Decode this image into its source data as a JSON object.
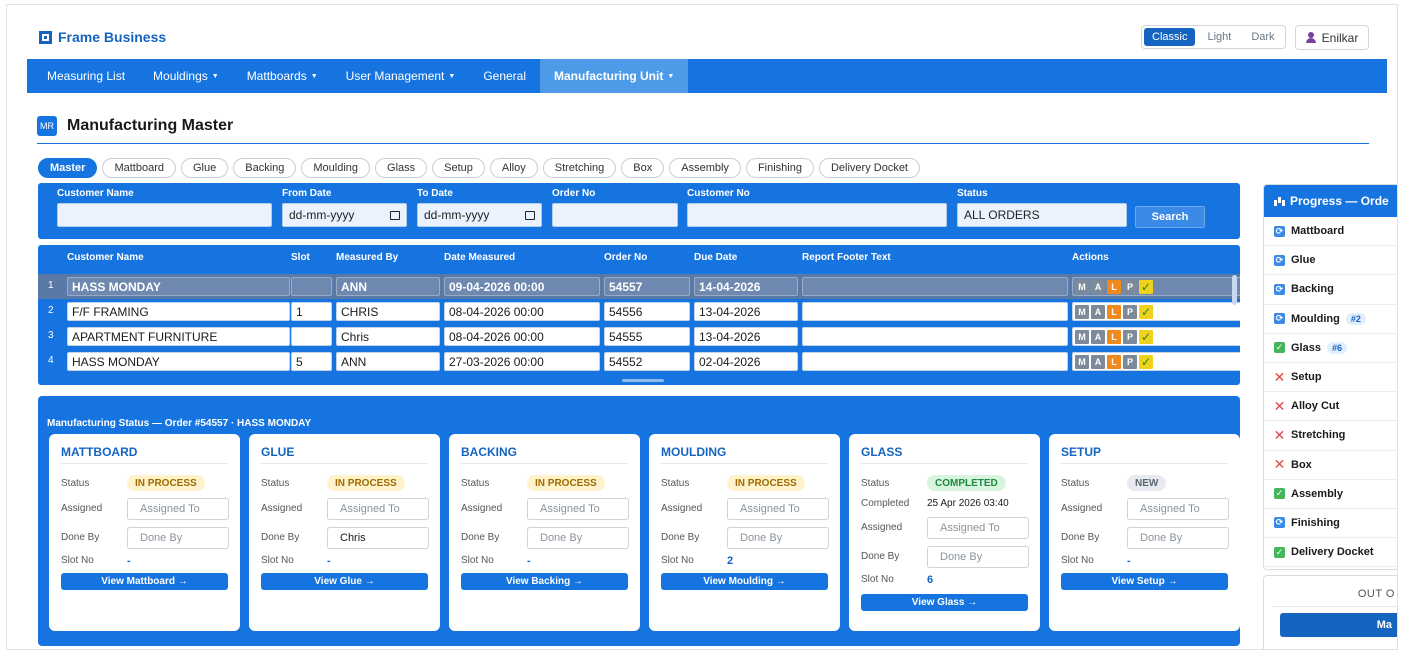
{
  "app": {
    "brand": "Frame Business",
    "themes": [
      "Classic",
      "Light",
      "Dark"
    ],
    "user": "Enilkar"
  },
  "nav": [
    {
      "label": "Measuring List",
      "caret": false
    },
    {
      "label": "Mouldings",
      "caret": true
    },
    {
      "label": "Mattboards",
      "caret": true
    },
    {
      "label": "User Management",
      "caret": true
    },
    {
      "label": "General",
      "caret": false
    },
    {
      "label": "Manufacturing Unit",
      "caret": true
    }
  ],
  "page": {
    "title": "Manufacturing Master",
    "icon_text": "MR"
  },
  "tabs": [
    "Master",
    "Mattboard",
    "Glue",
    "Backing",
    "Moulding",
    "Glass",
    "Setup",
    "Alloy",
    "Stretching",
    "Box",
    "Assembly",
    "Finishing",
    "Delivery Docket"
  ],
  "filters": {
    "customer_name_label": "Customer Name",
    "customer_name_value": "",
    "from_date_label": "From Date",
    "from_date_value": "dd-mm-yyyy",
    "to_date_label": "To Date",
    "to_date_value": "dd-mm-yyyy",
    "order_no_label": "Order No",
    "order_no_value": "",
    "customer_no_label": "Customer No",
    "customer_no_value": "",
    "status_label": "Status",
    "status_value": "ALL ORDERS",
    "search_label": "Search"
  },
  "orders": {
    "columns": [
      "Customer Name",
      "Slot",
      "Measured By",
      "Date Measured",
      "Order No",
      "Due Date",
      "Report Footer Text",
      "Actions"
    ],
    "action_labels": [
      "M",
      "A",
      "L",
      "P",
      "✓"
    ],
    "rows": [
      {
        "num": "1",
        "customer": "HASS MONDAY",
        "slot": "",
        "measured_by": "ANN",
        "date_measured": "09-04-2026 00:00",
        "order_no": "54557",
        "due_date": "14-04-2026",
        "footer": ""
      },
      {
        "num": "2",
        "customer": "F/F FRAMING",
        "slot": "1",
        "measured_by": "CHRIS",
        "date_measured": "08-04-2026 00:00",
        "order_no": "54556",
        "due_date": "13-04-2026",
        "footer": ""
      },
      {
        "num": "3",
        "customer": "APARTMENT FURNITURE",
        "slot": "",
        "measured_by": "Chris",
        "date_measured": "08-04-2026 00:00",
        "order_no": "54555",
        "due_date": "13-04-2026",
        "footer": ""
      },
      {
        "num": "4",
        "customer": "HASS MONDAY",
        "slot": "5",
        "measured_by": "ANN",
        "date_measured": "27-03-2026 00:00",
        "order_no": "54552",
        "due_date": "02-04-2026",
        "footer": ""
      }
    ]
  },
  "status_panel": {
    "title": "Manufacturing Status — Order #54557 · HASS MONDAY",
    "labels": {
      "status": "Status",
      "assigned": "Assigned",
      "done_by": "Done By",
      "slot_no": "Slot No",
      "completed": "Completed"
    },
    "cards": [
      {
        "title": "MATTBOARD",
        "status": "IN PROCESS",
        "assigned": "Assigned To",
        "done_by": "Done By",
        "done_by_filled": false,
        "slot": "-",
        "view": "View Mattboard →"
      },
      {
        "title": "GLUE",
        "status": "IN PROCESS",
        "assigned": "Assigned To",
        "done_by": "Chris",
        "done_by_filled": true,
        "slot": "-",
        "view": "View Glue →"
      },
      {
        "title": "BACKING",
        "status": "IN PROCESS",
        "assigned": "Assigned To",
        "done_by": "Done By",
        "done_by_filled": false,
        "slot": "-",
        "view": "View Backing →"
      },
      {
        "title": "MOULDING",
        "status": "IN PROCESS",
        "assigned": "Assigned To",
        "done_by": "Done By",
        "done_by_filled": false,
        "slot": "2",
        "view": "View Moulding →"
      },
      {
        "title": "GLASS",
        "status": "COMPLETED",
        "completed": "25 Apr 2026 03:40",
        "assigned": "Assigned To",
        "done_by": "Done By",
        "done_by_filled": false,
        "slot": "6",
        "view": "View Glass →"
      },
      {
        "title": "SETUP",
        "status": "NEW",
        "assigned": "Assigned To",
        "done_by": "Done By",
        "done_by_filled": false,
        "slot": "-",
        "view": "View Setup →"
      }
    ]
  },
  "progress": {
    "title": "Progress — Orde",
    "items": [
      {
        "label": "Mattboard",
        "state": "info",
        "count": ""
      },
      {
        "label": "Glue",
        "state": "info",
        "count": ""
      },
      {
        "label": "Backing",
        "state": "info",
        "count": ""
      },
      {
        "label": "Moulding",
        "state": "info",
        "count": "#2"
      },
      {
        "label": "Glass",
        "state": "ok",
        "count": "#6"
      },
      {
        "label": "Setup",
        "state": "x",
        "count": ""
      },
      {
        "label": "Alloy Cut",
        "state": "x",
        "count": ""
      },
      {
        "label": "Stretching",
        "state": "x",
        "count": ""
      },
      {
        "label": "Box",
        "state": "x",
        "count": ""
      },
      {
        "label": "Assembly",
        "state": "ok",
        "count": ""
      },
      {
        "label": "Finishing",
        "state": "info",
        "count": ""
      },
      {
        "label": "Delivery Docket",
        "state": "ok",
        "count": ""
      }
    ],
    "out_title": "OUT O",
    "out_button": "Ma"
  },
  "colors": {
    "primary": "#1674e0",
    "accent_orange": "#f08a1c",
    "ok_green": "#43b55a",
    "error_red": "#e04848"
  }
}
